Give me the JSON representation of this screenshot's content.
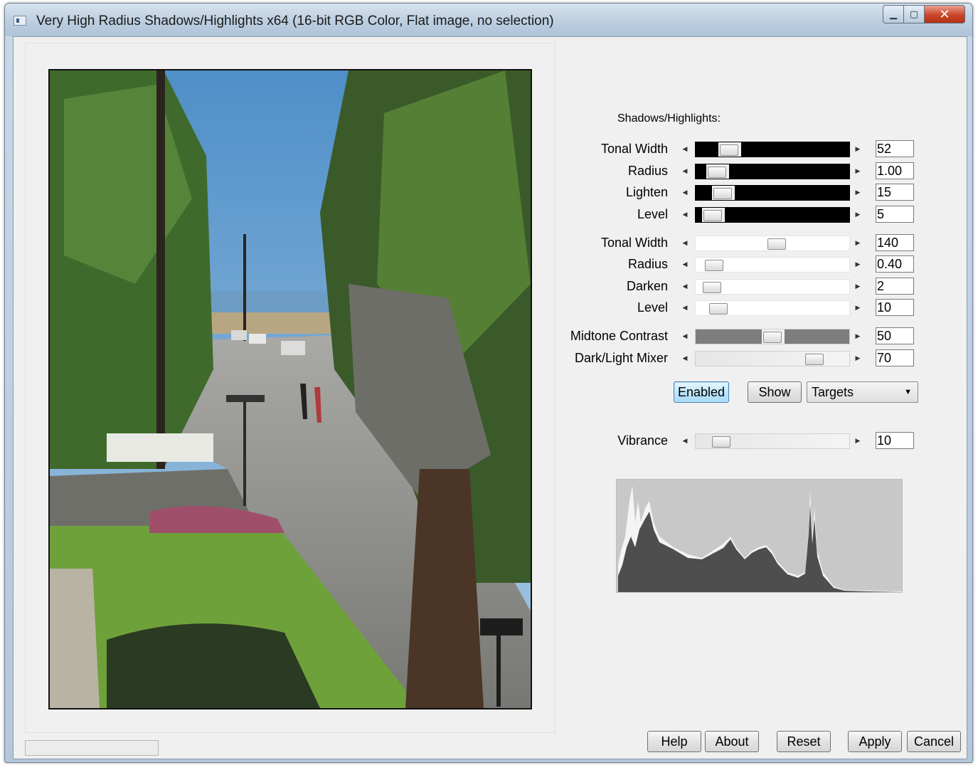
{
  "window": {
    "title": "Very High Radius Shadows/Highlights x64 (16-bit RGB Color, Flat image, no selection)",
    "minimize_glyph": "▁",
    "maximize_glyph": "▢",
    "close_glyph": "✕"
  },
  "panel": {
    "section_title": "Shadows/Highlights:",
    "shadows_sliders": [
      {
        "label": "Tonal Width",
        "value": "52",
        "level": 0.18
      },
      {
        "label": "Radius",
        "value": "1.00",
        "level": 0.09
      },
      {
        "label": "Lighten",
        "value": "15",
        "level": 0.13
      },
      {
        "label": "Level",
        "value": "5",
        "level": 0.06
      }
    ],
    "highlights_sliders": [
      {
        "label": "Tonal Width",
        "value": "140",
        "level": 0.53
      },
      {
        "label": "Radius",
        "value": "0.40",
        "level": 0.07
      },
      {
        "label": "Darken",
        "value": "2",
        "level": 0.05
      },
      {
        "label": "Level",
        "value": "10",
        "level": 0.1
      }
    ],
    "tone_sliders": [
      {
        "label": "Midtone Contrast",
        "value": "50",
        "level": 0.5
      },
      {
        "label": "Dark/Light Mixer",
        "value": "70",
        "level": 0.81
      }
    ],
    "enabled_label": "Enabled",
    "show_label": "Show",
    "targets_label": "Targets",
    "vibrance": {
      "label": "Vibrance",
      "value": "10",
      "level": 0.12
    }
  },
  "footer": {
    "help_label": "Help",
    "about_label": "About",
    "reset_label": "Reset",
    "apply_label": "Apply",
    "cancel_label": "Cancel"
  },
  "colors": {
    "enabled_button": "#bee6fd",
    "dark_track": "#000000",
    "contrast_track": "#7d7d7d",
    "histogram_bg": "#c8c8c8"
  },
  "icons": {
    "left_arrow": "◀",
    "right_arrow": "▶",
    "dropdown": "▼"
  }
}
